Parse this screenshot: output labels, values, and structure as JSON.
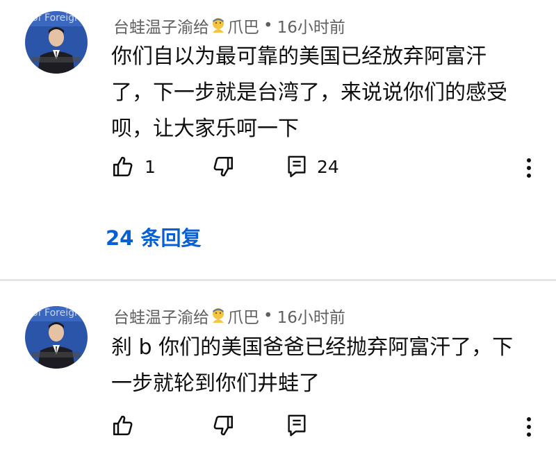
{
  "comments": [
    {
      "author": "台蛙温子渝给",
      "badge_icon": "member-badge-icon",
      "channel": "爪巴",
      "separator": "•",
      "time": "16小时前",
      "text_lines": [
        "你们自以为最可靠的美国已经放弃阿富汗",
        "了，下一步就是台湾了，来说说你们的感受",
        "呗，让大家乐呵一下"
      ],
      "like_count": "1",
      "reply_count": "24",
      "replies_link": "24 条回复"
    },
    {
      "author": "台蛙温子渝给",
      "badge_icon": "member-badge-icon",
      "channel": "爪巴",
      "separator": "•",
      "time": "16小时前",
      "text_lines": [
        "刹 b 你们的美国爸爸已经抛弃阿富汗了，下",
        "一步就轮到你们井蛙了"
      ]
    }
  ],
  "avatar_overlay_text": "of Foreign",
  "colors": {
    "link": "#065fd4",
    "meta_text": "#606060",
    "divider": "#e5e5e5"
  }
}
